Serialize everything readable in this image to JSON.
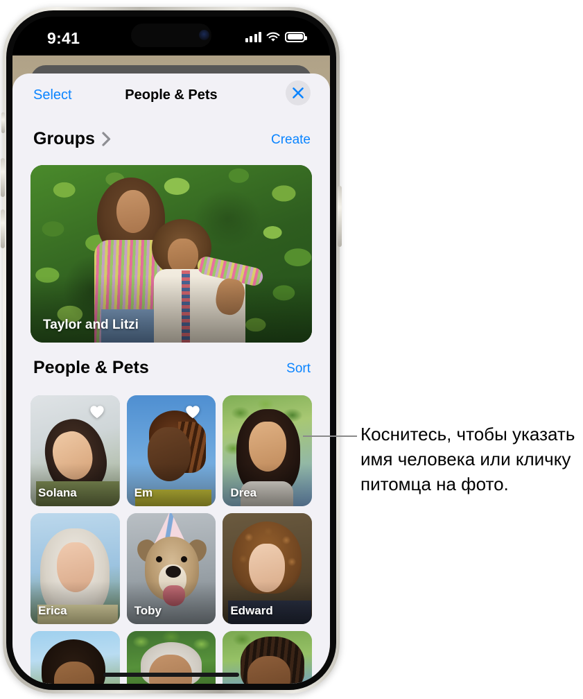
{
  "status_bar": {
    "time": "9:41",
    "cellular_icon": "signal-bars-icon",
    "wifi_icon": "wifi-icon",
    "battery_icon": "battery-icon"
  },
  "sheet": {
    "nav": {
      "left_button": "Select",
      "title": "People & Pets",
      "close_icon": "close-icon"
    },
    "groups_section": {
      "title": "Groups",
      "chevron_icon": "chevron-right-icon",
      "action": "Create",
      "card": {
        "label": "Taylor and Litzi"
      }
    },
    "people_section": {
      "title": "People & Pets",
      "action": "Sort",
      "tiles": [
        {
          "name": "Solana",
          "favorite": true,
          "favorite_icon": "heart-icon",
          "kind": "person"
        },
        {
          "name": "Em",
          "favorite": true,
          "favorite_icon": "heart-icon",
          "kind": "person"
        },
        {
          "name": "Drea",
          "favorite": false,
          "kind": "person"
        },
        {
          "name": "Erica",
          "favorite": false,
          "kind": "person"
        },
        {
          "name": "Toby",
          "favorite": false,
          "kind": "pet"
        },
        {
          "name": "Edward",
          "favorite": false,
          "kind": "person"
        },
        {
          "name": "",
          "favorite": false,
          "kind": "person"
        },
        {
          "name": "",
          "favorite": false,
          "kind": "person"
        },
        {
          "name": "",
          "favorite": false,
          "kind": "person"
        }
      ]
    }
  },
  "callout": {
    "text": "Коснитесь, чтобы указать имя человека или кличку питомца на фото."
  },
  "colors": {
    "accent_blue": "#0a84ff",
    "sheet_background": "#f2f1f6",
    "close_button_background": "#e2e1e6",
    "leader_line": "#8a8a8a"
  }
}
